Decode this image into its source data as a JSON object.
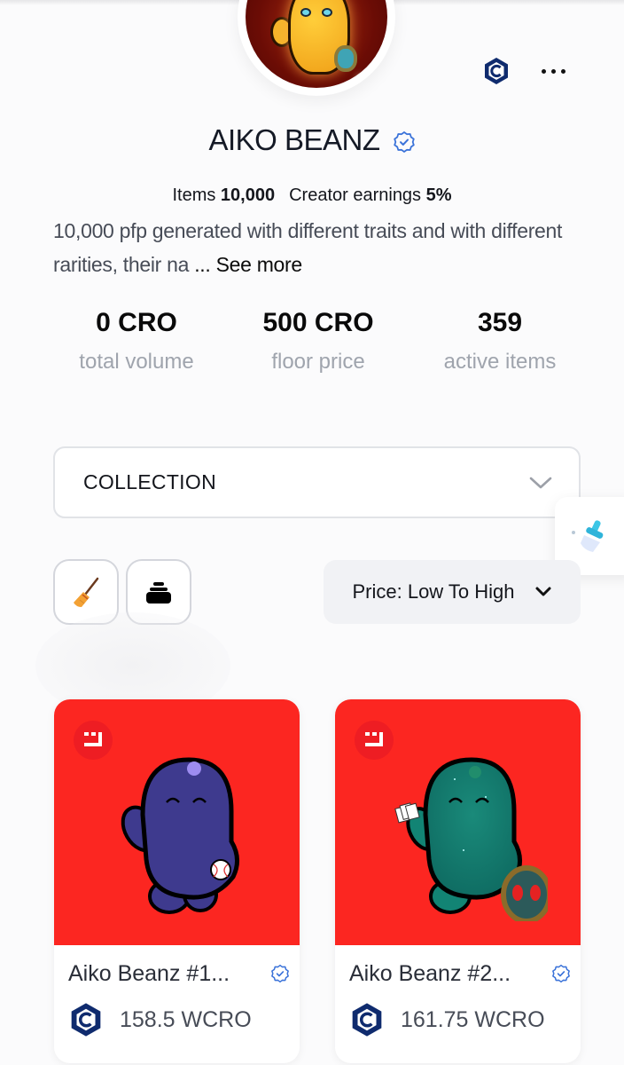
{
  "collection": {
    "name": "AIKO BEANZ",
    "verified": true,
    "items_label": "Items",
    "items_value": "10,000",
    "earnings_label": "Creator earnings",
    "earnings_value": "5%",
    "description": "10,000 pfp generated with different traits and with different rarities, their na",
    "ellipsis": "...",
    "see_more_label": "See more"
  },
  "header_icons": {
    "chain": "cronos-icon",
    "more": "more-options-icon"
  },
  "stats": [
    {
      "value": "0 CRO",
      "label": "total volume"
    },
    {
      "value": "500 CRO",
      "label": "floor price"
    },
    {
      "value": "359",
      "label": "active items"
    }
  ],
  "filters": {
    "collection_dropdown": "COLLECTION",
    "sort_dropdown": "Price: Low To High",
    "tool_buttons": [
      "broom-icon",
      "weight-icon"
    ]
  },
  "colors": {
    "card_background": "#fc2621",
    "verified_blue": "#3b73d9",
    "cronos_navy": "#0f2b6e"
  },
  "items": [
    {
      "name": "Aiko Beanz #1...",
      "price": "158.5 WCRO",
      "verified": true
    },
    {
      "name": "Aiko Beanz #2...",
      "price": "161.75 WCRO",
      "verified": true
    }
  ]
}
